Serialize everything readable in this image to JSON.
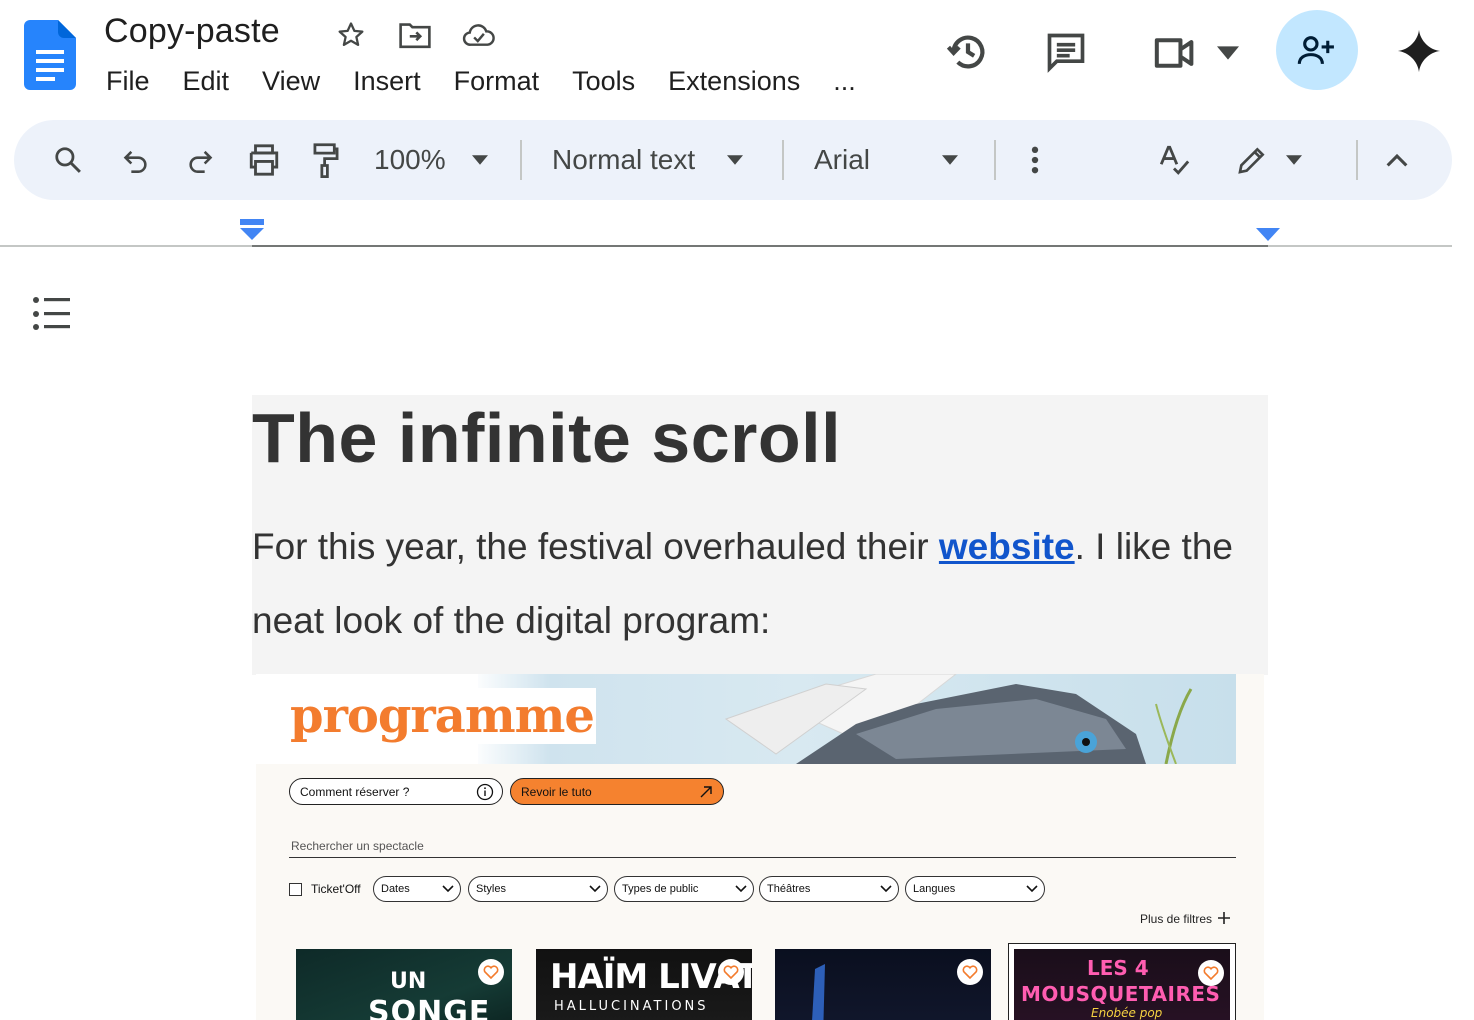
{
  "app": {
    "doc_title": "Copy-paste",
    "menu": [
      "File",
      "Edit",
      "View",
      "Insert",
      "Format",
      "Tools",
      "Extensions",
      "..."
    ],
    "brand_color": "#1a73e8",
    "share_bg": "#c2e7ff"
  },
  "toolbar": {
    "zoom": "100%",
    "style": "Normal text",
    "font": "Arial"
  },
  "document": {
    "heading": "The infinite scroll",
    "para_before": "For this year, the festival overhauled their ",
    "link_text": "website",
    "para_after": ". I like the neat look of the digital program:"
  },
  "embed": {
    "title": "programme",
    "accent": "#f37c2e",
    "how_to_book": "Comment réserver ?",
    "replay_tutorial": "Revoir le tuto",
    "search_placeholder": "Rechercher un spectacle",
    "ticketoff": "Ticket'Off",
    "selects": [
      "Dates",
      "Styles",
      "Types de public",
      "Théâtres",
      "Langues"
    ],
    "more_filters": "Plus de filtres",
    "cards": [
      {
        "line1": "UN",
        "line2": "SONGE"
      },
      {
        "line1": "HAÏM LIVAT",
        "line2": "HALLUCINATIONS"
      },
      {
        "line1": "",
        "line2": ""
      },
      {
        "line1": "LES 4",
        "line2": "MOUSQUETAIRES",
        "line3": "Enobée pop"
      }
    ]
  }
}
